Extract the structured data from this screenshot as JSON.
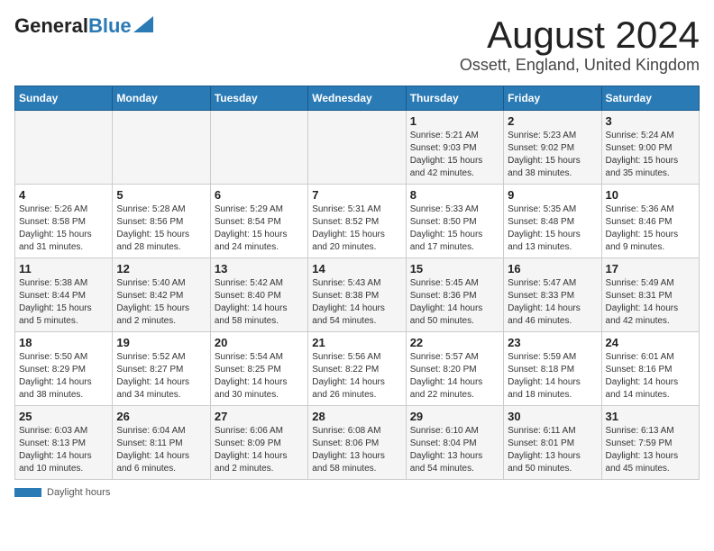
{
  "logo": {
    "general": "General",
    "blue": "Blue"
  },
  "title": "August 2024",
  "subtitle": "Ossett, England, United Kingdom",
  "days_header": [
    "Sunday",
    "Monday",
    "Tuesday",
    "Wednesday",
    "Thursday",
    "Friday",
    "Saturday"
  ],
  "weeks": [
    [
      {
        "day": "",
        "info": ""
      },
      {
        "day": "",
        "info": ""
      },
      {
        "day": "",
        "info": ""
      },
      {
        "day": "",
        "info": ""
      },
      {
        "day": "1",
        "info": "Sunrise: 5:21 AM\nSunset: 9:03 PM\nDaylight: 15 hours\nand 42 minutes."
      },
      {
        "day": "2",
        "info": "Sunrise: 5:23 AM\nSunset: 9:02 PM\nDaylight: 15 hours\nand 38 minutes."
      },
      {
        "day": "3",
        "info": "Sunrise: 5:24 AM\nSunset: 9:00 PM\nDaylight: 15 hours\nand 35 minutes."
      }
    ],
    [
      {
        "day": "4",
        "info": "Sunrise: 5:26 AM\nSunset: 8:58 PM\nDaylight: 15 hours\nand 31 minutes."
      },
      {
        "day": "5",
        "info": "Sunrise: 5:28 AM\nSunset: 8:56 PM\nDaylight: 15 hours\nand 28 minutes."
      },
      {
        "day": "6",
        "info": "Sunrise: 5:29 AM\nSunset: 8:54 PM\nDaylight: 15 hours\nand 24 minutes."
      },
      {
        "day": "7",
        "info": "Sunrise: 5:31 AM\nSunset: 8:52 PM\nDaylight: 15 hours\nand 20 minutes."
      },
      {
        "day": "8",
        "info": "Sunrise: 5:33 AM\nSunset: 8:50 PM\nDaylight: 15 hours\nand 17 minutes."
      },
      {
        "day": "9",
        "info": "Sunrise: 5:35 AM\nSunset: 8:48 PM\nDaylight: 15 hours\nand 13 minutes."
      },
      {
        "day": "10",
        "info": "Sunrise: 5:36 AM\nSunset: 8:46 PM\nDaylight: 15 hours\nand 9 minutes."
      }
    ],
    [
      {
        "day": "11",
        "info": "Sunrise: 5:38 AM\nSunset: 8:44 PM\nDaylight: 15 hours\nand 5 minutes."
      },
      {
        "day": "12",
        "info": "Sunrise: 5:40 AM\nSunset: 8:42 PM\nDaylight: 15 hours\nand 2 minutes."
      },
      {
        "day": "13",
        "info": "Sunrise: 5:42 AM\nSunset: 8:40 PM\nDaylight: 14 hours\nand 58 minutes."
      },
      {
        "day": "14",
        "info": "Sunrise: 5:43 AM\nSunset: 8:38 PM\nDaylight: 14 hours\nand 54 minutes."
      },
      {
        "day": "15",
        "info": "Sunrise: 5:45 AM\nSunset: 8:36 PM\nDaylight: 14 hours\nand 50 minutes."
      },
      {
        "day": "16",
        "info": "Sunrise: 5:47 AM\nSunset: 8:33 PM\nDaylight: 14 hours\nand 46 minutes."
      },
      {
        "day": "17",
        "info": "Sunrise: 5:49 AM\nSunset: 8:31 PM\nDaylight: 14 hours\nand 42 minutes."
      }
    ],
    [
      {
        "day": "18",
        "info": "Sunrise: 5:50 AM\nSunset: 8:29 PM\nDaylight: 14 hours\nand 38 minutes."
      },
      {
        "day": "19",
        "info": "Sunrise: 5:52 AM\nSunset: 8:27 PM\nDaylight: 14 hours\nand 34 minutes."
      },
      {
        "day": "20",
        "info": "Sunrise: 5:54 AM\nSunset: 8:25 PM\nDaylight: 14 hours\nand 30 minutes."
      },
      {
        "day": "21",
        "info": "Sunrise: 5:56 AM\nSunset: 8:22 PM\nDaylight: 14 hours\nand 26 minutes."
      },
      {
        "day": "22",
        "info": "Sunrise: 5:57 AM\nSunset: 8:20 PM\nDaylight: 14 hours\nand 22 minutes."
      },
      {
        "day": "23",
        "info": "Sunrise: 5:59 AM\nSunset: 8:18 PM\nDaylight: 14 hours\nand 18 minutes."
      },
      {
        "day": "24",
        "info": "Sunrise: 6:01 AM\nSunset: 8:16 PM\nDaylight: 14 hours\nand 14 minutes."
      }
    ],
    [
      {
        "day": "25",
        "info": "Sunrise: 6:03 AM\nSunset: 8:13 PM\nDaylight: 14 hours\nand 10 minutes."
      },
      {
        "day": "26",
        "info": "Sunrise: 6:04 AM\nSunset: 8:11 PM\nDaylight: 14 hours\nand 6 minutes."
      },
      {
        "day": "27",
        "info": "Sunrise: 6:06 AM\nSunset: 8:09 PM\nDaylight: 14 hours\nand 2 minutes."
      },
      {
        "day": "28",
        "info": "Sunrise: 6:08 AM\nSunset: 8:06 PM\nDaylight: 13 hours\nand 58 minutes."
      },
      {
        "day": "29",
        "info": "Sunrise: 6:10 AM\nSunset: 8:04 PM\nDaylight: 13 hours\nand 54 minutes."
      },
      {
        "day": "30",
        "info": "Sunrise: 6:11 AM\nSunset: 8:01 PM\nDaylight: 13 hours\nand 50 minutes."
      },
      {
        "day": "31",
        "info": "Sunrise: 6:13 AM\nSunset: 7:59 PM\nDaylight: 13 hours\nand 45 minutes."
      }
    ]
  ],
  "footer": {
    "label": "Daylight hours"
  }
}
